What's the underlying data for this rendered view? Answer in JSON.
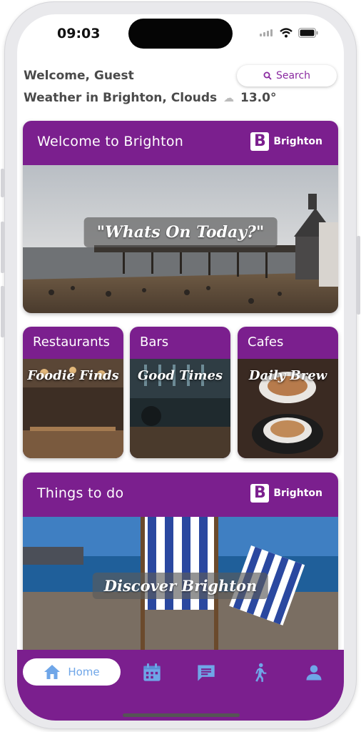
{
  "status_bar": {
    "time": "09:03"
  },
  "header": {
    "welcome": "Welcome, Guest",
    "weather": "Weather in Brighton, Clouds",
    "temperature": "13.0°",
    "search_label": "Search"
  },
  "brand_name": "Brighton",
  "hero_card": {
    "title": "Welcome to Brighton",
    "overlay": "\"Whats On Today?\""
  },
  "categories": [
    {
      "title": "Restaurants",
      "overlay": "Foodie Finds"
    },
    {
      "title": "Bars",
      "overlay": "Good Times"
    },
    {
      "title": "Cafes",
      "overlay": "Daily Brew"
    }
  ],
  "things_card": {
    "title": "Things to do",
    "overlay": "Discover Brighton"
  },
  "nav": {
    "home_label": "Home",
    "items": [
      "home-icon",
      "calendar-icon",
      "chat-icon",
      "walking-icon",
      "person-icon"
    ]
  },
  "colors": {
    "brand_purple": "#7b1f8e",
    "accent_blue": "#6fa6e8"
  }
}
